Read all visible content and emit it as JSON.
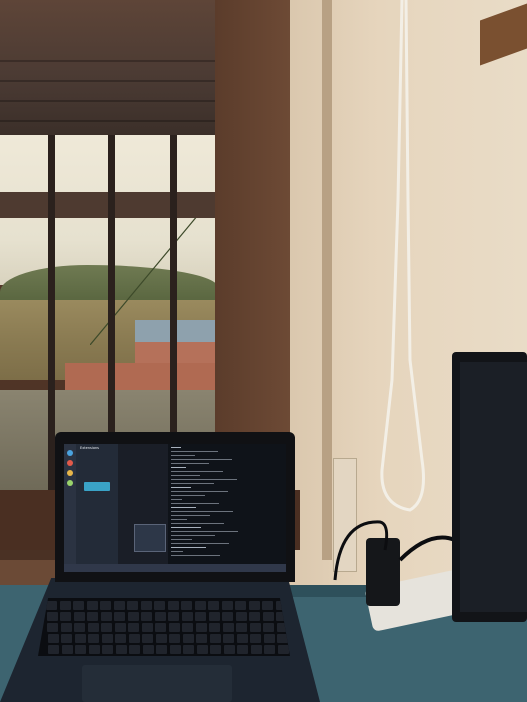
{
  "scene": {
    "description_tags": [
      "window",
      "laptop",
      "monitor",
      "power-strip",
      "desk"
    ]
  },
  "laptop_screen": {
    "window_title": "Extensions"
  },
  "colors": {
    "wall": "#e6d5bd",
    "window_frame": "#4a3124",
    "desk": "#3d6470",
    "laptop_body": "#1d2530",
    "screen_accent": "#3aa3c7"
  }
}
